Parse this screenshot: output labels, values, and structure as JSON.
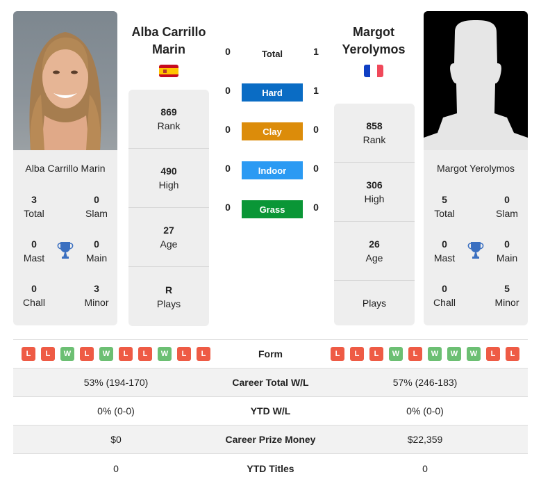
{
  "player1": {
    "name_header": "Alba Carrillo Marin",
    "card_name": "Alba Carrillo Marin",
    "country": "Spain",
    "flag_colors": [
      "#c60b1e",
      "#ffc400",
      "#c60b1e"
    ],
    "titles": {
      "total": {
        "value": "3",
        "label": "Total"
      },
      "slam": {
        "value": "0",
        "label": "Slam"
      },
      "mast": {
        "value": "0",
        "label": "Mast"
      },
      "main": {
        "value": "0",
        "label": "Main"
      },
      "chall": {
        "value": "0",
        "label": "Chall"
      },
      "minor": {
        "value": "3",
        "label": "Minor"
      }
    },
    "info": [
      {
        "value": "869",
        "label": "Rank"
      },
      {
        "value": "490",
        "label": "High"
      },
      {
        "value": "27",
        "label": "Age"
      },
      {
        "value": "R",
        "label": "Plays"
      }
    ],
    "form": [
      "L",
      "L",
      "W",
      "L",
      "W",
      "L",
      "L",
      "W",
      "L",
      "L"
    ]
  },
  "player2": {
    "name_header": "Margot Yerolymos",
    "card_name": "Margot Yerolymos",
    "country": "France",
    "flag_colors": [
      "#0f3fc4",
      "#ffffff",
      "#f0495a"
    ],
    "titles": {
      "total": {
        "value": "5",
        "label": "Total"
      },
      "slam": {
        "value": "0",
        "label": "Slam"
      },
      "mast": {
        "value": "0",
        "label": "Mast"
      },
      "main": {
        "value": "0",
        "label": "Main"
      },
      "chall": {
        "value": "0",
        "label": "Chall"
      },
      "minor": {
        "value": "5",
        "label": "Minor"
      }
    },
    "info": [
      {
        "value": "858",
        "label": "Rank"
      },
      {
        "value": "306",
        "label": "High"
      },
      {
        "value": "26",
        "label": "Age"
      },
      {
        "value": "",
        "label": "Plays"
      }
    ],
    "form": [
      "L",
      "L",
      "L",
      "W",
      "L",
      "W",
      "W",
      "W",
      "L",
      "L"
    ]
  },
  "h2h": [
    {
      "label": "Total",
      "p1": "0",
      "p2": "1",
      "color": ""
    },
    {
      "label": "Hard",
      "p1": "0",
      "p2": "1",
      "color": "#0a6cc4"
    },
    {
      "label": "Clay",
      "p1": "0",
      "p2": "0",
      "color": "#dc8c0a"
    },
    {
      "label": "Indoor",
      "p1": "0",
      "p2": "0",
      "color": "#2b9af3"
    },
    {
      "label": "Grass",
      "p1": "0",
      "p2": "0",
      "color": "#0a9636"
    }
  ],
  "table": {
    "form_label": "Form",
    "rows": [
      {
        "label": "Career Total W/L",
        "p1": "53% (194-170)",
        "p2": "57% (246-183)"
      },
      {
        "label": "YTD W/L",
        "p1": "0% (0-0)",
        "p2": "0% (0-0)"
      },
      {
        "label": "Career Prize Money",
        "p1": "$0",
        "p2": "$22,359"
      },
      {
        "label": "YTD Titles",
        "p1": "0",
        "p2": "0"
      }
    ]
  },
  "icons": {
    "trophy": "trophy-icon",
    "trophy_color": "#3a6fc0"
  }
}
